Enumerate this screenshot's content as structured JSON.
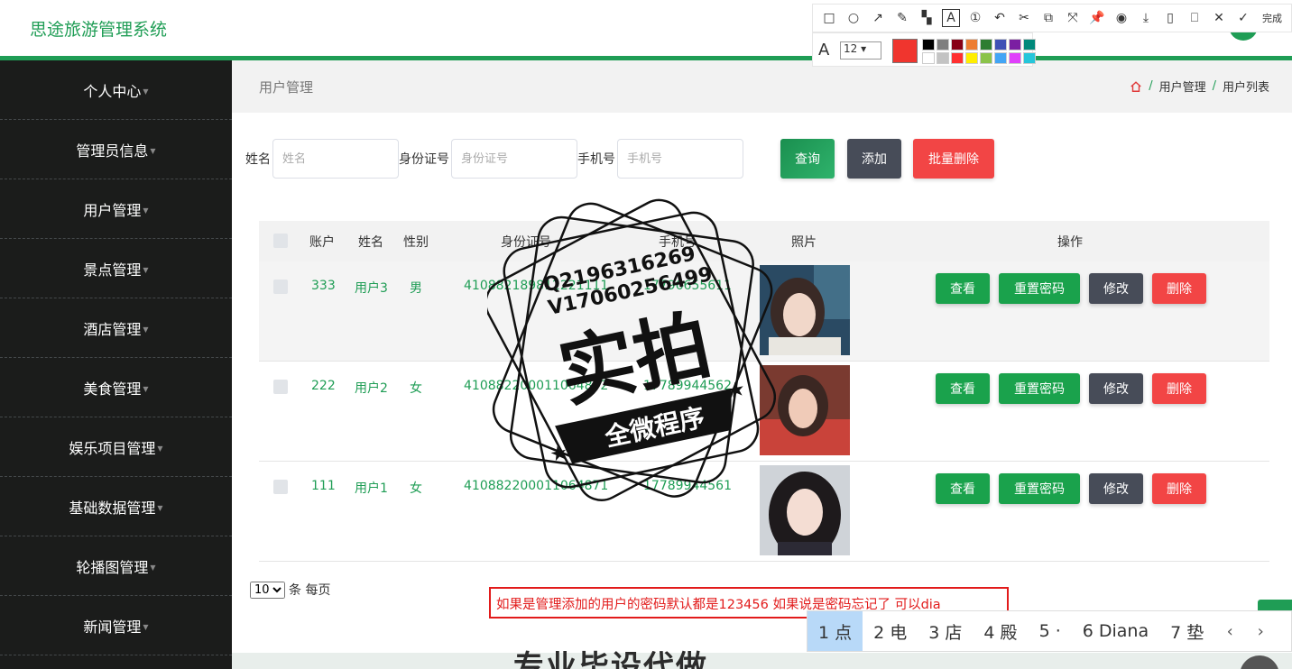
{
  "header": {
    "title": "思途旅游管理系统"
  },
  "sidebar": {
    "items": [
      {
        "label": "个人中心"
      },
      {
        "label": "管理员信息"
      },
      {
        "label": "用户管理"
      },
      {
        "label": "景点管理"
      },
      {
        "label": "酒店管理"
      },
      {
        "label": "美食管理"
      },
      {
        "label": "娱乐项目管理"
      },
      {
        "label": "基础数据管理"
      },
      {
        "label": "轮播图管理"
      },
      {
        "label": "新闻管理"
      }
    ]
  },
  "page": {
    "title": "用户管理",
    "breadcrumb": [
      "用户管理",
      "用户列表"
    ]
  },
  "search": {
    "name_label": "姓名",
    "name_placeholder": "姓名",
    "id_label": "身份证号",
    "id_placeholder": "身份证号",
    "phone_label": "手机号",
    "phone_placeholder": "手机号",
    "query": "查询",
    "add": "添加",
    "batch_delete": "批量删除"
  },
  "table": {
    "headers": [
      "账户",
      "姓名",
      "性别",
      "身份证号",
      "手机号",
      "照片",
      "操作"
    ],
    "rows": [
      {
        "account": "333",
        "name": "用户3",
        "gender": "男",
        "id_number": "410882189812221111",
        "phone": "17796655611"
      },
      {
        "account": "222",
        "name": "用户2",
        "gender": "女",
        "id_number": "410882200011064872",
        "phone": "17789944562"
      },
      {
        "account": "111",
        "name": "用户1",
        "gender": "女",
        "id_number": "410882200011064871",
        "phone": "17789944561"
      }
    ],
    "actions": {
      "view": "查看",
      "reset": "重置密码",
      "edit": "修改",
      "delete": "删除"
    }
  },
  "pager": {
    "page_size": "10",
    "suffix": "条 每页"
  },
  "watermark": {
    "line1": "Q2196316269",
    "line2": "V17060256499",
    "main": "实拍",
    "banner": "全微程序"
  },
  "bottom": {
    "text": "专业毕设代做"
  },
  "annotation_toolbar": {
    "done": "完成",
    "font_size": "12"
  },
  "note": {
    "text": "如果是管理添加的用户的密码默认都是123456 如果说是密码忘记了 可以dia"
  },
  "ime": {
    "candidates": [
      "1 点",
      "2 电",
      "3 店",
      "4 殿",
      "5 ·",
      "6 Diana",
      "7 垫"
    ]
  },
  "colors": {
    "accent": "#1f9d55",
    "danger": "#f24545",
    "dark": "#474c58",
    "sidebar": "#1b1c1b"
  }
}
